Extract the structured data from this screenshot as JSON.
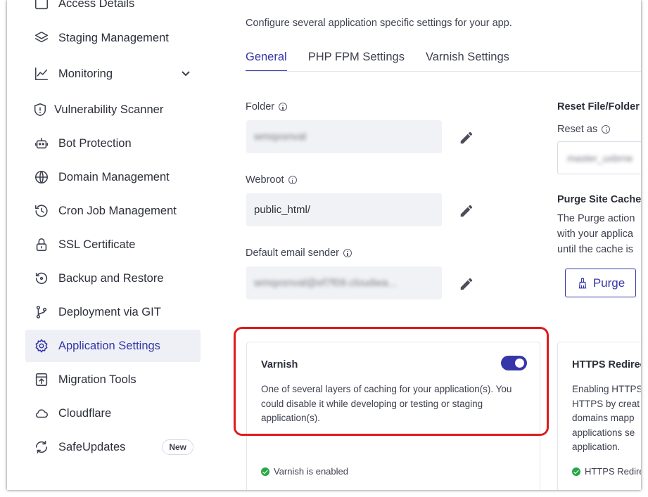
{
  "sidebar": {
    "items": [
      {
        "label": "Access Details",
        "icon": "access-icon"
      },
      {
        "label": "Staging Management",
        "icon": "layers-icon"
      },
      {
        "label": "Monitoring",
        "icon": "chart-line-icon"
      },
      {
        "label": "Vulnerability Scanner",
        "icon": "shield-warning-icon"
      },
      {
        "label": "Bot Protection",
        "icon": "robot-icon"
      },
      {
        "label": "Domain Management",
        "icon": "www-globe-icon"
      },
      {
        "label": "Cron Job Management",
        "icon": "history-clock-icon"
      },
      {
        "label": "SSL Certificate",
        "icon": "lock-icon"
      },
      {
        "label": "Backup and Restore",
        "icon": "backup-restore-icon"
      },
      {
        "label": "Deployment via GIT",
        "icon": "git-branch-icon"
      },
      {
        "label": "Application Settings",
        "icon": "gear-icon"
      },
      {
        "label": "Migration Tools",
        "icon": "upload-box-icon"
      },
      {
        "label": "Cloudflare",
        "icon": "cloud-icon"
      },
      {
        "label": "SafeUpdates",
        "icon": "refresh-icon",
        "badge": "New"
      }
    ],
    "active": "Application Settings"
  },
  "main": {
    "subtitle": "Configure several application specific settings for your app.",
    "tabs": [
      {
        "label": "General",
        "active": true
      },
      {
        "label": "PHP FPM Settings",
        "active": false
      },
      {
        "label": "Varnish Settings",
        "active": false
      }
    ],
    "fields": {
      "folder": {
        "label": "Folder",
        "value": "wmqxsnval"
      },
      "webroot": {
        "label": "Webroot",
        "value": "public_html/"
      },
      "email": {
        "label": "Default email sender",
        "value": "wmqxsnval@ef7f09.cloudwa..."
      }
    }
  },
  "right": {
    "reset_title": "Reset File/Folder Permissions",
    "reset_as_label": "Reset as",
    "reset_as_value": "master_uxbrne",
    "purge_title": "Purge Site Cache",
    "purge_text": [
      "The Purge action",
      "with your applica",
      "until the cache is"
    ],
    "purge_button": "Purge"
  },
  "cards": {
    "varnish": {
      "title": "Varnish",
      "description": "One of several layers of caching for your application(s). You could disable it while developing or testing or staging application(s).",
      "status": "Varnish is enabled",
      "enabled": true
    },
    "https": {
      "title": "HTTPS Redirection",
      "description": [
        "Enabling HTTPS",
        "HTTPS by creat",
        "domains mapp",
        "applications se",
        "application."
      ],
      "status": "HTTPS Redirection"
    }
  },
  "colors": {
    "accent": "#3537a8",
    "highlight": "#e01b1b",
    "success": "#28a745"
  }
}
